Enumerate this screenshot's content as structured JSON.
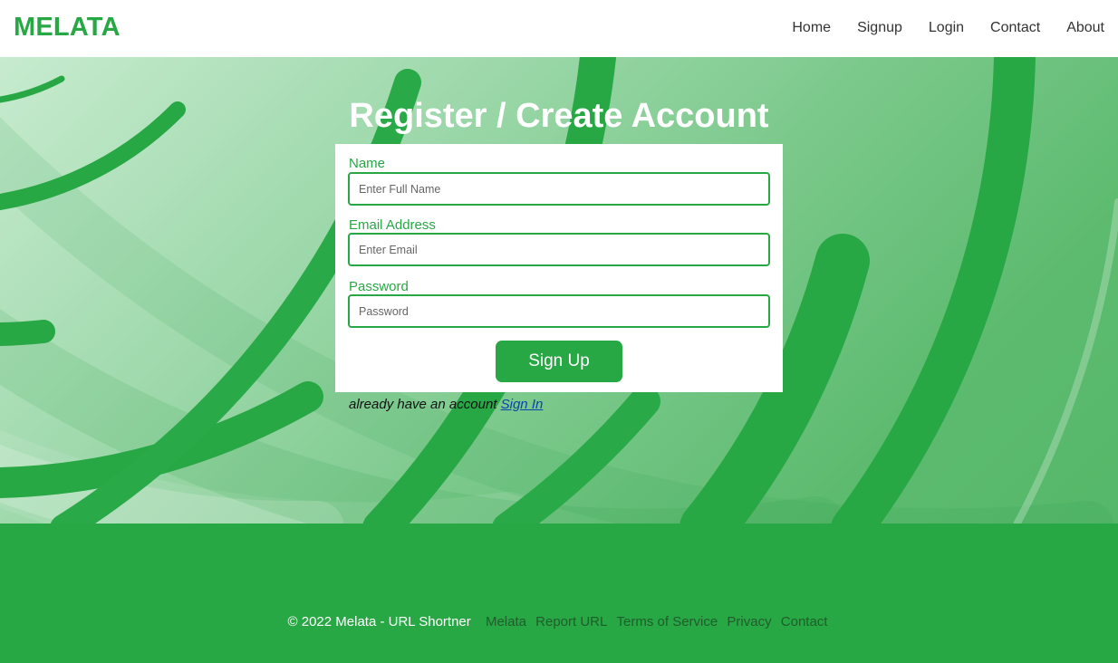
{
  "header": {
    "logo": "MELATA",
    "nav": [
      "Home",
      "Signup",
      "Login",
      "Contact",
      "About"
    ]
  },
  "form": {
    "title": "Register / Create Account",
    "fields": [
      {
        "label": "Name",
        "placeholder": "Enter Full Name",
        "value": ""
      },
      {
        "label": "Email Address",
        "placeholder": "Enter Email",
        "value": ""
      },
      {
        "label": "Password",
        "placeholder": "Password",
        "value": ""
      }
    ],
    "submit_label": "Sign Up",
    "signin_prompt": "already have an account",
    "signin_link": "Sign In"
  },
  "footer": {
    "copyright": "© 2022 Melata - URL Shortner",
    "links": [
      "Melata",
      "Report URL",
      "Terms of Service",
      "Privacy",
      "Contact"
    ]
  },
  "colors": {
    "accent": "#28a745",
    "hero_light": "#c7ebcf",
    "hero_dark": "#55b769",
    "footer_link": "#1f5d2c",
    "signin_link": "#0645ad"
  }
}
